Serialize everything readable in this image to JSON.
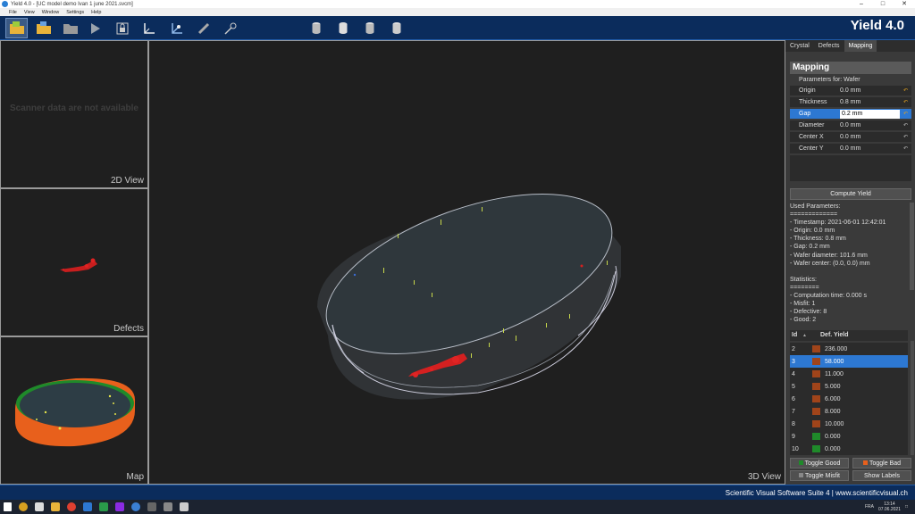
{
  "window": {
    "title": "Yield 4.0 - [UC model demo Ivan 1 june 2021.svcm]"
  },
  "menu": [
    "File",
    "View",
    "Window",
    "Settings",
    "Help"
  ],
  "brand": "Yield 4.0",
  "views": {
    "v2d_label": "2D View",
    "not_available": "Scanner data are not available",
    "defects_label": "Defects",
    "map_label": "Map",
    "v3d_label": "3D View"
  },
  "panel": {
    "tabs": [
      "Crystal",
      "Defects",
      "Mapping"
    ],
    "mapping_title": "Mapping",
    "params_for": "Parameters for: Wafer",
    "params": [
      {
        "name": "Origin",
        "value": "0.0 mm"
      },
      {
        "name": "Thickness",
        "value": "0.8 mm"
      },
      {
        "name": "Gap",
        "value": "0.2 mm"
      },
      {
        "name": "Diameter",
        "value": "0.0 mm"
      },
      {
        "name": "Center X",
        "value": "0.0 mm"
      },
      {
        "name": "Center Y",
        "value": "0.0 mm"
      }
    ],
    "compute_label": "Compute Yield",
    "info": {
      "used_title": "Used Parameters:",
      "sep1": "=============",
      "timestamp": "- Timestamp: 2021-06-01 12:42:01",
      "origin": "- Origin: 0.0 mm",
      "thickness": "- Thickness: 0.8 mm",
      "gap": "- Gap: 0.2 mm",
      "diameter": "- Wafer diameter: 101.6 mm",
      "center": "- Wafer center: (0.0, 0.0) mm",
      "stats_title": "Statistics:",
      "sep2": "========",
      "comp_time": "- Computation time: 0.000 s",
      "misfit": "- Misfit: 1",
      "defective": "- Defective: 8",
      "good": "- Good: 2"
    },
    "table": {
      "col_id": "Id",
      "sort_arrow": "▲",
      "col_yield": "Def. Yield",
      "rows": [
        {
          "id": "2",
          "yield": "236.000",
          "color": "#a0441a"
        },
        {
          "id": "3",
          "yield": "58.000",
          "color": "#a0441a"
        },
        {
          "id": "4",
          "yield": "11.000",
          "color": "#a0441a"
        },
        {
          "id": "5",
          "yield": "5.000",
          "color": "#a0441a"
        },
        {
          "id": "6",
          "yield": "6.000",
          "color": "#a0441a"
        },
        {
          "id": "7",
          "yield": "8.000",
          "color": "#a0441a"
        },
        {
          "id": "8",
          "yield": "10.000",
          "color": "#a0441a"
        },
        {
          "id": "9",
          "yield": "0.000",
          "color": "#1f8a2a"
        },
        {
          "id": "10",
          "yield": "0.000",
          "color": "#1f8a2a"
        }
      ]
    },
    "buttons": {
      "toggle_good": "Toggle Good",
      "toggle_bad": "Toggle Bad",
      "toggle_misfit": "Toggle Misfit",
      "show_labels": "Show Labels"
    }
  },
  "status": "Scientific Visual Software Suite 4 | www.scientificvisual.ch",
  "tray": {
    "lang": "FRA",
    "time": "13:14",
    "date": "07.06.2021"
  },
  "colors": {
    "toolbar": "#0b2c5c",
    "accent": "#2d78d2",
    "defect": "#d42020",
    "map_orange": "#e8601c",
    "map_green": "#1f8a2a"
  }
}
